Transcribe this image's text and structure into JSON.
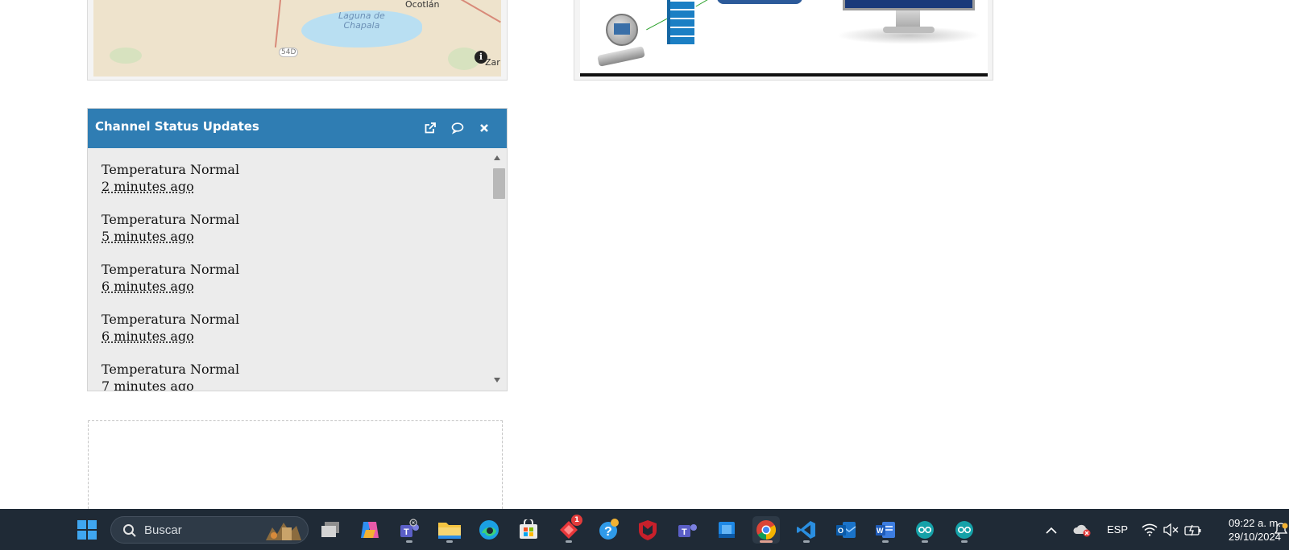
{
  "map": {
    "lake_label_line1": "Laguna de",
    "lake_label_line2": "Chapala",
    "town_label": "Ocotlán",
    "route_label": "54D",
    "edge_label": "Zar",
    "info_icon": "info-icon"
  },
  "status_widget": {
    "title": "Channel Status Updates",
    "buttons": [
      {
        "name": "open-external-icon"
      },
      {
        "name": "comment-icon"
      },
      {
        "name": "close-icon"
      }
    ],
    "items": [
      {
        "status": "Temperatura Normal",
        "time": "2 minutes ago"
      },
      {
        "status": "Temperatura Normal",
        "time": "5 minutes ago"
      },
      {
        "status": "Temperatura Normal",
        "time": "6 minutes ago"
      },
      {
        "status": "Temperatura Normal",
        "time": "6 minutes ago"
      },
      {
        "status": "Temperatura Normal",
        "time": "7 minutes ago"
      }
    ],
    "header_color": "#2f7db3"
  },
  "taskbar": {
    "search_placeholder": "Buscar",
    "apps": [
      {
        "name": "windows-start-icon"
      },
      {
        "name": "task-view-icon"
      },
      {
        "name": "copilot-icon"
      },
      {
        "name": "teams-icon"
      },
      {
        "name": "file-explorer-icon"
      },
      {
        "name": "edge-icon"
      },
      {
        "name": "microsoft-store-icon"
      },
      {
        "name": "app-red-diamond-icon",
        "badge": "1"
      },
      {
        "name": "help-icon"
      },
      {
        "name": "mcafee-icon"
      },
      {
        "name": "teams-work-icon"
      },
      {
        "name": "app-blue-icon"
      },
      {
        "name": "chrome-icon"
      },
      {
        "name": "vscode-icon"
      },
      {
        "name": "outlook-icon"
      },
      {
        "name": "word-icon"
      },
      {
        "name": "arduino-icon"
      },
      {
        "name": "arduino-icon-2"
      }
    ],
    "tray": {
      "language": "ESP",
      "time": "09:22 a. m.",
      "date": "29/10/2024"
    }
  }
}
